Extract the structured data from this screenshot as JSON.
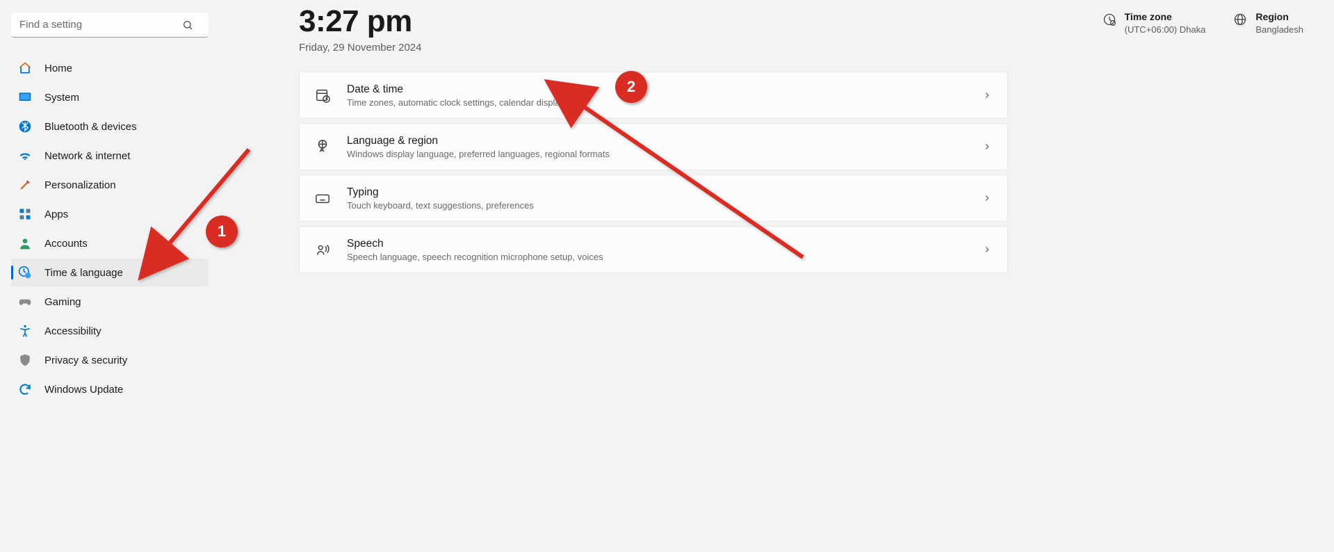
{
  "search": {
    "placeholder": "Find a setting"
  },
  "sidebar": [
    {
      "key": "home",
      "label": "Home"
    },
    {
      "key": "system",
      "label": "System"
    },
    {
      "key": "bluetooth",
      "label": "Bluetooth & devices"
    },
    {
      "key": "network",
      "label": "Network & internet"
    },
    {
      "key": "personalization",
      "label": "Personalization"
    },
    {
      "key": "apps",
      "label": "Apps"
    },
    {
      "key": "accounts",
      "label": "Accounts"
    },
    {
      "key": "time",
      "label": "Time & language"
    },
    {
      "key": "gaming",
      "label": "Gaming"
    },
    {
      "key": "accessibility",
      "label": "Accessibility"
    },
    {
      "key": "privacy",
      "label": "Privacy & security"
    },
    {
      "key": "update",
      "label": "Windows Update"
    }
  ],
  "clock": {
    "time": "3:27 pm",
    "date": "Friday, 29 November 2024"
  },
  "header": {
    "timezone": {
      "label": "Time zone",
      "value": "(UTC+06:00) Dhaka"
    },
    "region": {
      "label": "Region",
      "value": "Bangladesh"
    }
  },
  "cards": [
    {
      "key": "datetime",
      "title": "Date & time",
      "sub": "Time zones, automatic clock settings, calendar display"
    },
    {
      "key": "language",
      "title": "Language & region",
      "sub": "Windows display language, preferred languages, regional formats"
    },
    {
      "key": "typing",
      "title": "Typing",
      "sub": "Touch keyboard, text suggestions, preferences"
    },
    {
      "key": "speech",
      "title": "Speech",
      "sub": "Speech language, speech recognition microphone setup, voices"
    }
  ],
  "annotations": {
    "badge1": "1",
    "badge2": "2"
  }
}
